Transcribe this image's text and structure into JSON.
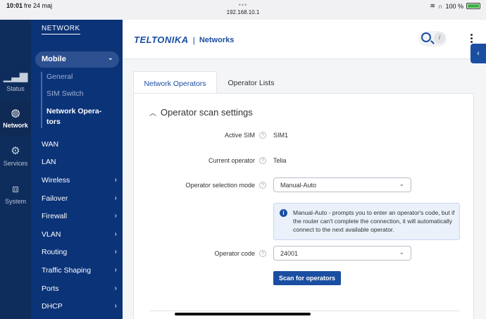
{
  "statusbar": {
    "time": "10:01",
    "date": "fre 24 maj",
    "url": "192.168.10.1",
    "battery": "100 %",
    "battery_level": 1.0
  },
  "rail": {
    "items": [
      {
        "label": "Status",
        "icon": "bar-chart-icon"
      },
      {
        "label": "Network",
        "icon": "globe-icon"
      },
      {
        "label": "Services",
        "icon": "gear-icon"
      },
      {
        "label": "System",
        "icon": "system-icon"
      }
    ]
  },
  "nav": {
    "title": "NETWORK",
    "expanded": "Mobile",
    "subitems": [
      "General",
      "SIM Switch",
      "Network Opera-\ntors"
    ],
    "menu": [
      "WAN",
      "LAN",
      "Wireless",
      "Failover",
      "Firewall",
      "VLAN",
      "Routing",
      "Traffic Shaping",
      "Ports",
      "DHCP"
    ]
  },
  "header": {
    "brand": "TELTONIKA",
    "separator": "|",
    "product": "Networks",
    "search_shortcut": "/",
    "accent": "#1a4ea1"
  },
  "tabs": [
    "Network Operators",
    "Operator Lists"
  ],
  "section": {
    "title": "Operator scan settings",
    "active_sim_label": "Active SIM",
    "active_sim_value": "SIM1",
    "current_operator_label": "Current operator",
    "current_operator_value": "Telia",
    "selection_mode_label": "Operator selection mode",
    "selection_mode_value": "Manual-Auto",
    "info_text": "Manual-Auto - prompts you to enter an operator's code, but if the router can't complete the connection, it will automatically connect to the next available operator.",
    "operator_code_label": "Operator code",
    "operator_code_value": "24001",
    "scan_button": "Scan for operators"
  }
}
